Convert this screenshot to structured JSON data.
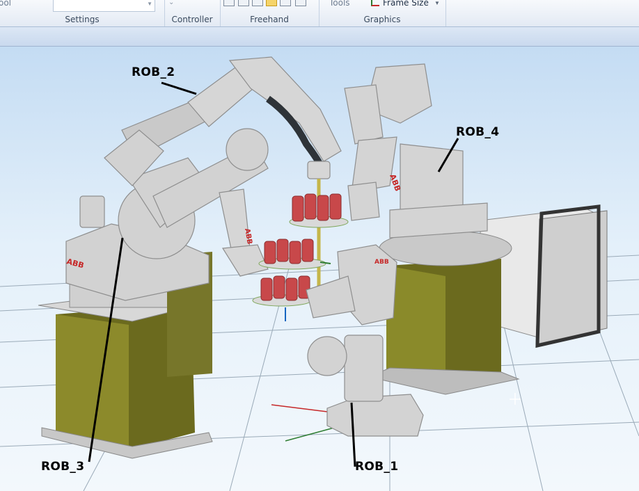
{
  "ribbon": {
    "clipped_left_text": "ool",
    "clipped_tools_text": "Tools",
    "groups": {
      "settings": "Settings",
      "controller": "Controller",
      "freehand": "Freehand",
      "graphics": "Graphics"
    },
    "frame_size_label": "Frame Size"
  },
  "viewport": {
    "robots": {
      "rob_1": "ROB_1",
      "rob_2": "ROB_2",
      "rob_3": "ROB_3",
      "rob_4": "ROB_4"
    },
    "brand": "ABB"
  },
  "colors": {
    "robot_body": "#d2d2d2",
    "pedestal": "#6b6a1e",
    "cans": "#c8484a",
    "floor_grid": "#9aaab8"
  }
}
